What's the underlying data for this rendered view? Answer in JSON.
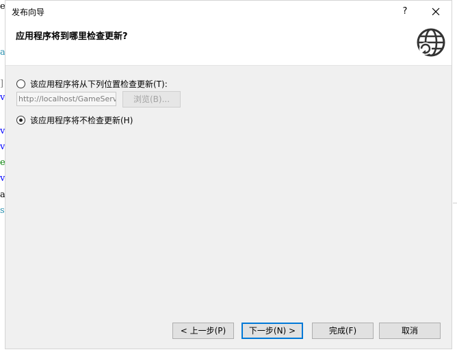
{
  "dialog": {
    "title": "发布向导",
    "help_label": "?",
    "heading": "应用程序将到哪里检查更新?",
    "header_icon": "globe-update-icon"
  },
  "options": {
    "check_from_location_label": "该应用程序将从下列位置检查更新(T):",
    "update_url_value": "http://localhost/GameServ",
    "browse_label": "浏览(B)...",
    "no_check_label": "该应用程序将不检查更新(H)",
    "selected": "no_check"
  },
  "buttons": {
    "prev": "< 上一步(P)",
    "next": "下一步(N) >",
    "finish": "完成(F)",
    "cancel": "取消"
  },
  "background_code": [
    {
      "char": "e",
      "color": "#000000"
    },
    {
      "char": "a",
      "color": "#2b91af"
    },
    {
      "char": "]",
      "color": "#7a7a7a"
    },
    {
      "char": "v",
      "color": "#0000ff"
    },
    {
      "char": "v",
      "color": "#0000ff"
    },
    {
      "char": "v",
      "color": "#0000ff"
    },
    {
      "char": "e",
      "color": "#008000"
    },
    {
      "char": "v",
      "color": "#0000ff"
    },
    {
      "char": "a",
      "color": "#000000"
    },
    {
      "char": "s",
      "color": "#2b91af"
    }
  ]
}
